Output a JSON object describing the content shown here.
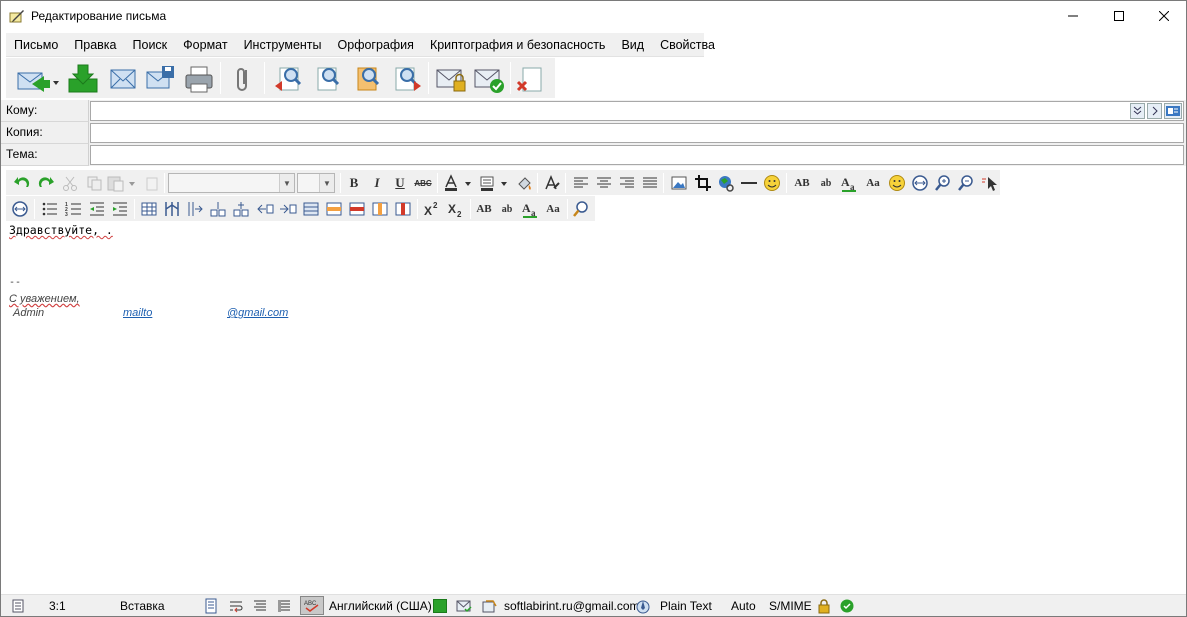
{
  "window": {
    "title": "Редактирование письма"
  },
  "menu": {
    "items": [
      "Письмо",
      "Правка",
      "Поиск",
      "Формат",
      "Инструменты",
      "Орфография",
      "Криптография и безопасность",
      "Вид",
      "Свойства"
    ]
  },
  "headers": {
    "to_label": "Кому:",
    "to_value": "",
    "cc_label": "Копия:",
    "cc_value": "",
    "subject_label": "Тема:",
    "subject_value": ""
  },
  "editor": {
    "greeting": "Здравствуйте, .",
    "sig_dashes": "--",
    "sig_regards": "С уважением,",
    "sig_name": "Admin",
    "sig_mailto": "mailto",
    "sig_email_domain": "@gmail.com"
  },
  "status": {
    "position": "3:1",
    "mode": "Вставка",
    "language": "Английский (США)",
    "account": "softlabirint.ru@gmail.com",
    "format": "Plain Text",
    "charset": "Auto",
    "security": "S/MIME"
  },
  "colors": {
    "toolbar_bg": "#f0f0f0",
    "accent_green": "#2aa12a",
    "accent_blue": "#3a78c2",
    "link": "#1d5fb0"
  }
}
